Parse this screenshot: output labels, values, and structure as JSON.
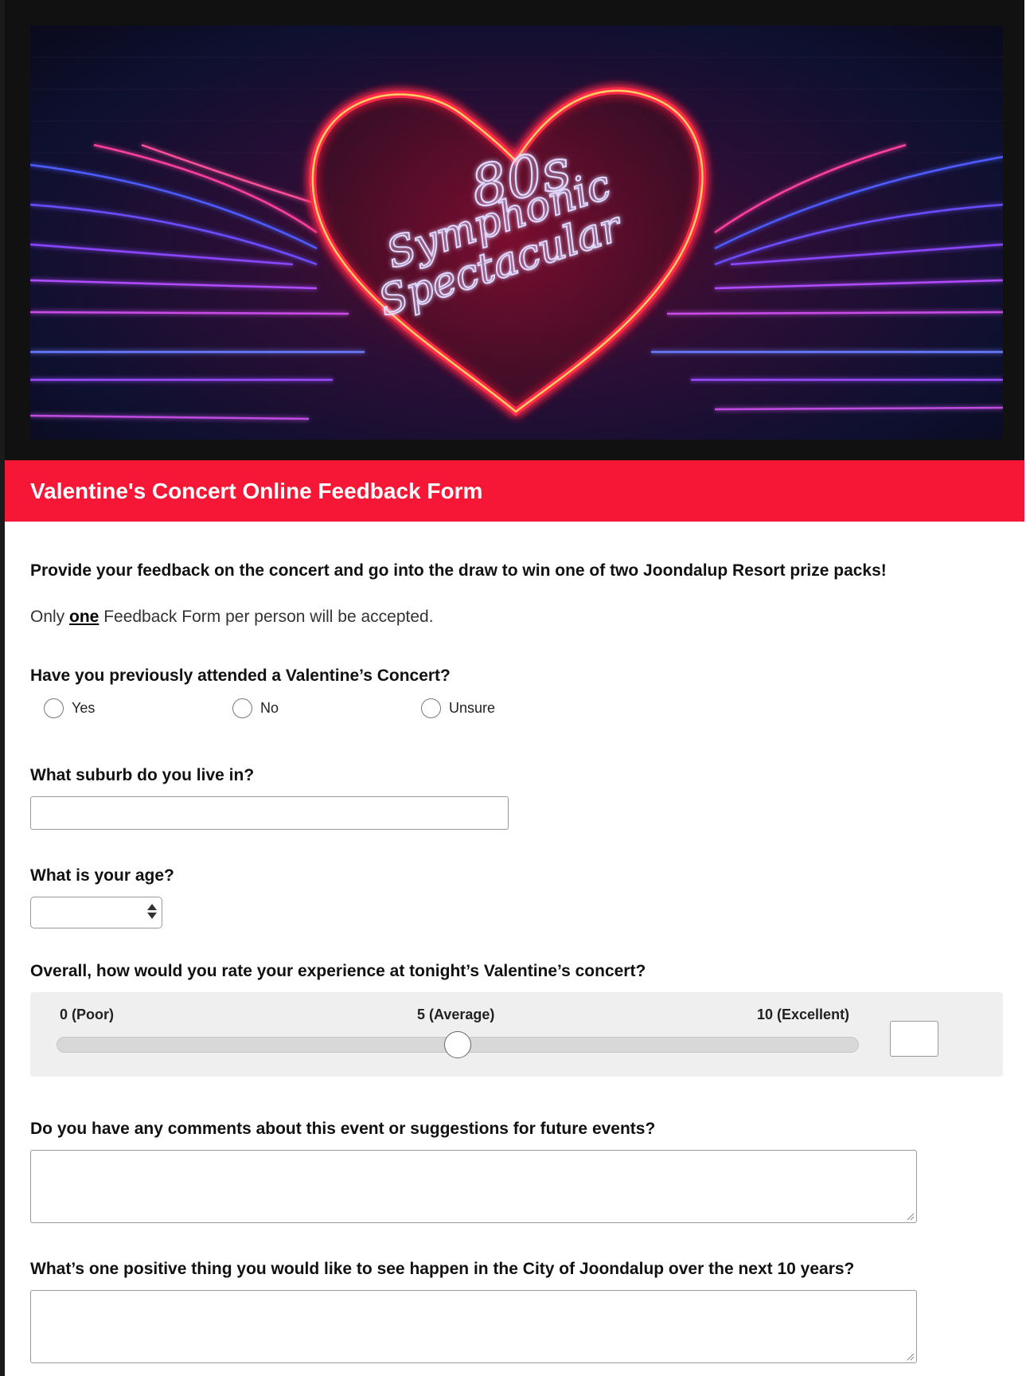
{
  "banner": {
    "line1": "80s",
    "line2": "Symphonic",
    "line3": "Spectacular"
  },
  "form": {
    "title": "Valentine's Concert Online Feedback Form",
    "intro": "Provide your feedback on the concert and go into the draw to win one of two Joondalup Resort prize packs!",
    "note_prefix": "Only ",
    "note_emphasis": "one",
    "note_suffix": " Feedback Form per person will be accepted."
  },
  "questions": {
    "attended": {
      "label": "Have you previously attended a Valentine’s Concert?",
      "options": [
        "Yes",
        "No",
        "Unsure"
      ]
    },
    "suburb": {
      "label": "What suburb do you live in?",
      "value": ""
    },
    "age": {
      "label": "What is your age?",
      "selected": ""
    },
    "rating": {
      "label": "Overall, how would you rate your experience at tonight’s Valentine’s concert?",
      "min_label": "0 (Poor)",
      "mid_label": "5 (Average)",
      "max_label": "10 (Excellent)",
      "min": 0,
      "max": 10,
      "value": 5,
      "display_value": ""
    },
    "comments": {
      "label": "Do you have any comments about this event or suggestions for future events?",
      "value": ""
    },
    "positive": {
      "label": "What’s one positive thing you would like to see happen in the City of Joondalup over the next 10 years?",
      "value": ""
    }
  },
  "colors": {
    "title_bar": "#f51735",
    "rating_panel": "#efefef"
  }
}
